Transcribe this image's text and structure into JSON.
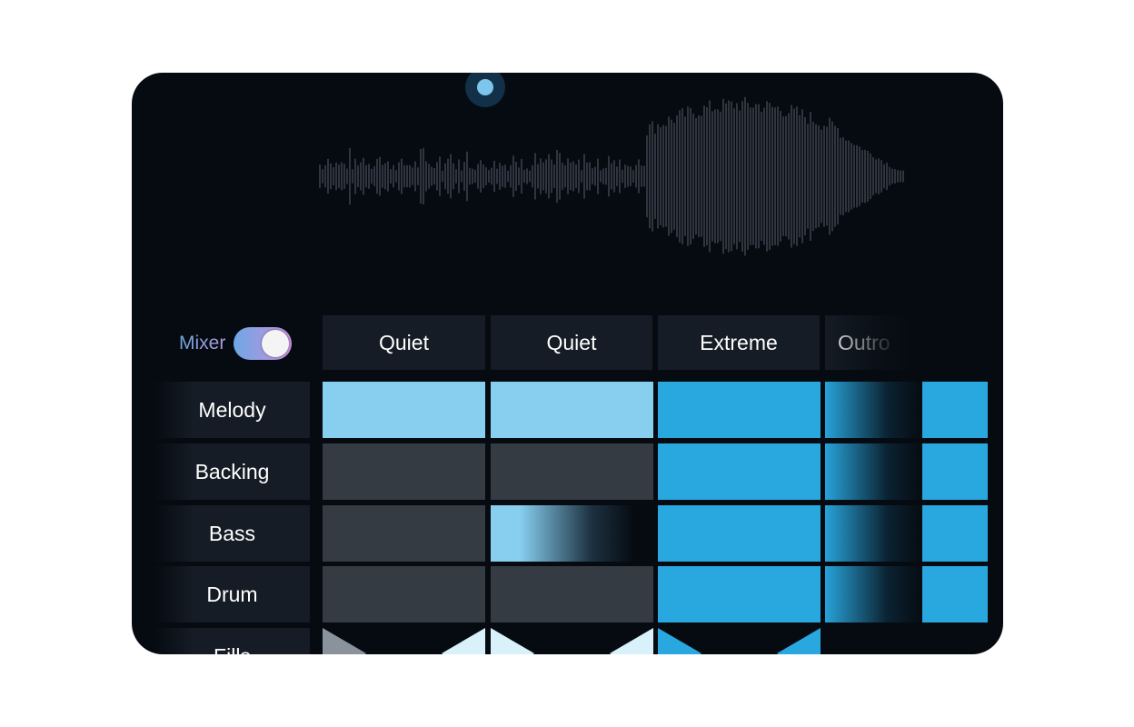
{
  "mixer": {
    "label": "Mixer",
    "enabled": true
  },
  "sections": [
    "Quiet",
    "Quiet",
    "Extreme",
    "Outro"
  ],
  "tracks": [
    {
      "label": "Melody",
      "states": [
        "light",
        "light",
        "full",
        "full"
      ]
    },
    {
      "label": "Backing",
      "states": [
        "off",
        "off",
        "full",
        "full"
      ]
    },
    {
      "label": "Bass",
      "states": [
        "off",
        "light-fade",
        "full",
        "full"
      ]
    },
    {
      "label": "Drum",
      "states": [
        "off",
        "off",
        "full",
        "full"
      ]
    },
    {
      "label": "Fills",
      "states": [
        "fill-gray",
        "fill-light",
        "fill-blue",
        "none"
      ]
    }
  ],
  "colors": {
    "panel_bg": "#060b12",
    "cell_off": "#353b42",
    "cell_light": "#87ceef",
    "cell_full": "#29a8e0",
    "fill_gray": "#8a929c",
    "fill_light": "#d9f1fb",
    "waveform": "#3a4049",
    "playhead": "#7cc5ec"
  },
  "icons": {
    "playhead": "playhead-handle-icon"
  }
}
